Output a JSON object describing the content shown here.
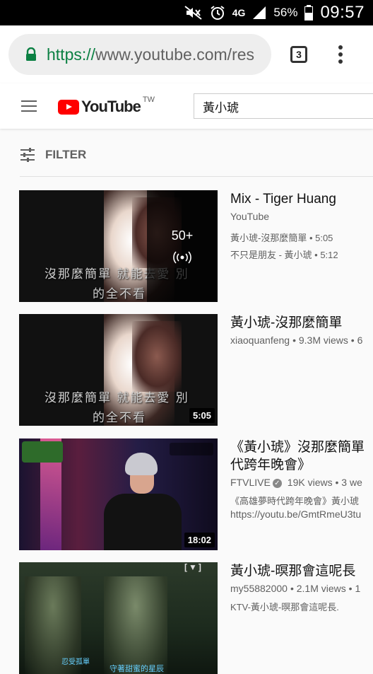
{
  "status_bar": {
    "network": "4G",
    "battery": "56%",
    "time": "09:57",
    "icons": [
      "mute-icon",
      "alarm-icon",
      "signal-icon",
      "battery-icon"
    ]
  },
  "browser": {
    "url_scheme": "https://",
    "url_rest": "www.youtube.com/res",
    "tab_count": "3",
    "lock_color": "#0b8043"
  },
  "youtube": {
    "logo_text": "YouTube",
    "region": "TW",
    "search_value": "黃小琥",
    "filter_label": "FILTER",
    "brand_color": "#ff0000"
  },
  "results": [
    {
      "title": "Mix - Tiger Huang",
      "channel": "YouTube",
      "mix_count": "50+",
      "sub_lines": [
        "黃小琥-沒那麼簡單 • 5:05",
        "不只是朋友 - 黃小琥 • 5:12"
      ],
      "thumb_lyric1": "沒那麼簡單 就能去愛 別",
      "thumb_lyric2": "的全不看"
    },
    {
      "title": "黃小琥-沒那麼簡單",
      "channel": "xiaoquanfeng",
      "views": "• 9.3M views • 6",
      "duration": "5:05",
      "thumb_lyric1": "沒那麼簡單 就能去愛 別",
      "thumb_lyric2": "的全不看"
    },
    {
      "title_line1": "《黃小琥》沒那麼簡單",
      "title_line2": "代跨年晚會》",
      "channel": "FTVLIVE",
      "views": "19K views • 3 we",
      "sub_lines": [
        "《高雄夢時代跨年晚會》黃小琥",
        "https://youtu.be/GmtRmeU3tu"
      ],
      "duration": "18:02"
    },
    {
      "title": "黃小琥-暝那會這呢長",
      "channel": "my55882000",
      "views": "• 2.1M views • 1",
      "sub_lines": [
        "KTV-黃小琥-暝那會這呢長."
      ],
      "thumb_sub1": "忍受孤單",
      "thumb_sub2": "守著甜蜜的星辰"
    }
  ]
}
